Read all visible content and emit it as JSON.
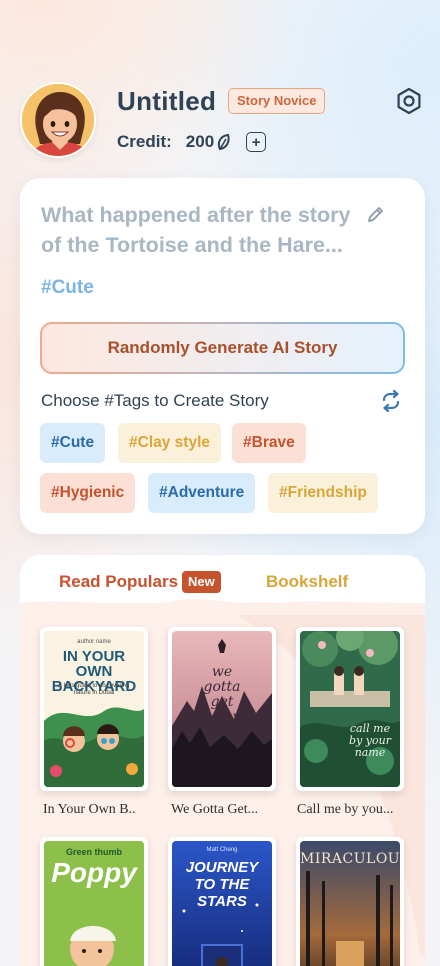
{
  "profile": {
    "name": "Untitled",
    "rank": "Story Novice",
    "credit_label": "Credit:",
    "credit_value": "200",
    "add_symbol": "+"
  },
  "story_card": {
    "prompt": "What happened after the story of the Tortoise and the Hare...",
    "selected_tag": "#Cute",
    "generate_button": "Randomly Generate AI Story",
    "choose_label": "Choose #Tags to Create Story",
    "tags": [
      "#Cute",
      "#Clay style",
      "#Brave",
      "#Hygienic",
      "#Adventure",
      "#Friendship"
    ]
  },
  "library": {
    "tabs": [
      "Read Populars",
      "Bookshelf"
    ],
    "new_badge": "New",
    "books": [
      {
        "title": "In Your Own B..",
        "cover_text": "In Your Own Backyard",
        "cover_small": "author name",
        "cover_sub": "a kids guide to discovering nature in Dubai"
      },
      {
        "title": "We Gotta Get...",
        "cover_text": "we gotta get away"
      },
      {
        "title": "Call me by you...",
        "cover_text": "call me by your name"
      },
      {
        "title": "",
        "cover_small": "Green thumb",
        "cover_text": "Poppy"
      },
      {
        "title": "",
        "cover_small": "Matt Cheng",
        "cover_text": "JOURNEY TO THE STARS"
      },
      {
        "title": "",
        "cover_text": "MIRACULOUS"
      }
    ]
  },
  "colors": {
    "primary_text": "#2f4256",
    "accent_red": "#c4532e",
    "accent_blue": "#2a6ca8",
    "accent_yellow": "#d9a63a"
  }
}
